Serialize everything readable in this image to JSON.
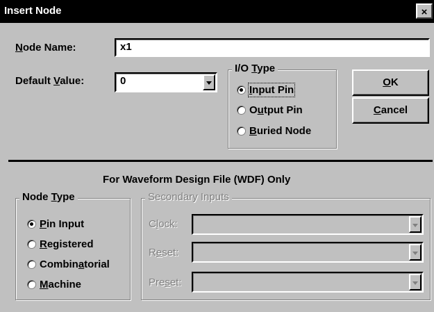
{
  "window": {
    "title": "Insert Node",
    "close": "×"
  },
  "node_name": {
    "label_pre": "",
    "label_u": "N",
    "label_post": "ode Name:",
    "value": "x1"
  },
  "default_value": {
    "label_pre": "Default ",
    "label_u": "V",
    "label_post": "alue:",
    "value": "0"
  },
  "io_type": {
    "legend_pre": "I/O ",
    "legend_u": "T",
    "legend_post": "ype",
    "options": [
      {
        "pre": "",
        "u": "I",
        "post": "nput Pin",
        "checked": true
      },
      {
        "pre": "O",
        "u": "u",
        "post": "tput Pin",
        "checked": false
      },
      {
        "pre": "",
        "u": "B",
        "post": "uried Node",
        "checked": false
      }
    ]
  },
  "buttons": {
    "ok": {
      "u": "O",
      "post": "K"
    },
    "cancel": {
      "u": "C",
      "post": "ancel"
    }
  },
  "wdf_section_label": "For Waveform Design File (WDF) Only",
  "node_type": {
    "legend_pre": "Node ",
    "legend_u": "T",
    "legend_post": "ype",
    "options": [
      {
        "pre": "",
        "u": "P",
        "post": "in Input",
        "checked": true
      },
      {
        "pre": "",
        "u": "R",
        "post": "egistered",
        "checked": false
      },
      {
        "pre": "Combin",
        "u": "a",
        "post": "torial",
        "checked": false
      },
      {
        "pre": "",
        "u": "M",
        "post": "achine",
        "checked": false
      }
    ]
  },
  "secondary_inputs": {
    "legend": "Secondary Inputs",
    "fields": [
      {
        "pre": "C",
        "u": "l",
        "post": "ock:",
        "value": ""
      },
      {
        "pre": "R",
        "u": "e",
        "post": "set:",
        "value": ""
      },
      {
        "pre": "Pre",
        "u": "s",
        "post": "et:",
        "value": ""
      }
    ]
  }
}
